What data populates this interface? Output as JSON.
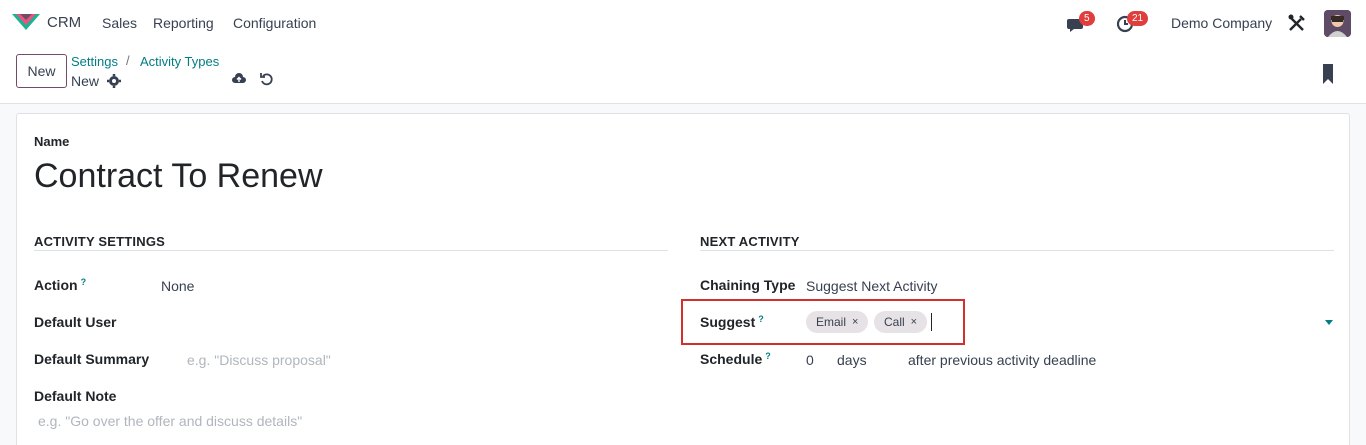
{
  "navbar": {
    "app_name": "CRM",
    "menu": [
      "Sales",
      "Reporting",
      "Configuration"
    ],
    "messages_badge": "5",
    "activities_badge": "21",
    "company": "Demo Company"
  },
  "control": {
    "new_label": "New",
    "breadcrumb": [
      "Settings",
      "Activity Types"
    ],
    "record_name": "New"
  },
  "form": {
    "name_label": "Name",
    "name_value": "Contract To Renew",
    "activity_settings": {
      "title": "ACTIVITY SETTINGS",
      "action_label": "Action",
      "action_help": "?",
      "action_value": "None",
      "default_user_label": "Default User",
      "default_summary_label": "Default Summary",
      "default_summary_placeholder": "e.g. \"Discuss proposal\"",
      "default_note_label": "Default Note",
      "default_note_placeholder": "e.g. \"Go over the offer and discuss details\""
    },
    "next_activity": {
      "title": "NEXT ACTIVITY",
      "chaining_type_label": "Chaining Type",
      "chaining_type_value": "Suggest Next Activity",
      "suggest_label": "Suggest",
      "suggest_help": "?",
      "suggest_tags": [
        "Email",
        "Call"
      ],
      "tag_remove": "×",
      "schedule_label": "Schedule",
      "schedule_help": "?",
      "schedule_value": "0",
      "schedule_unit": "days",
      "schedule_ref": "after previous activity deadline"
    }
  },
  "colors": {
    "brand": "#714b67",
    "link": "#017e84",
    "highlight": "#d32f2f",
    "badge": "#e03d3d"
  }
}
